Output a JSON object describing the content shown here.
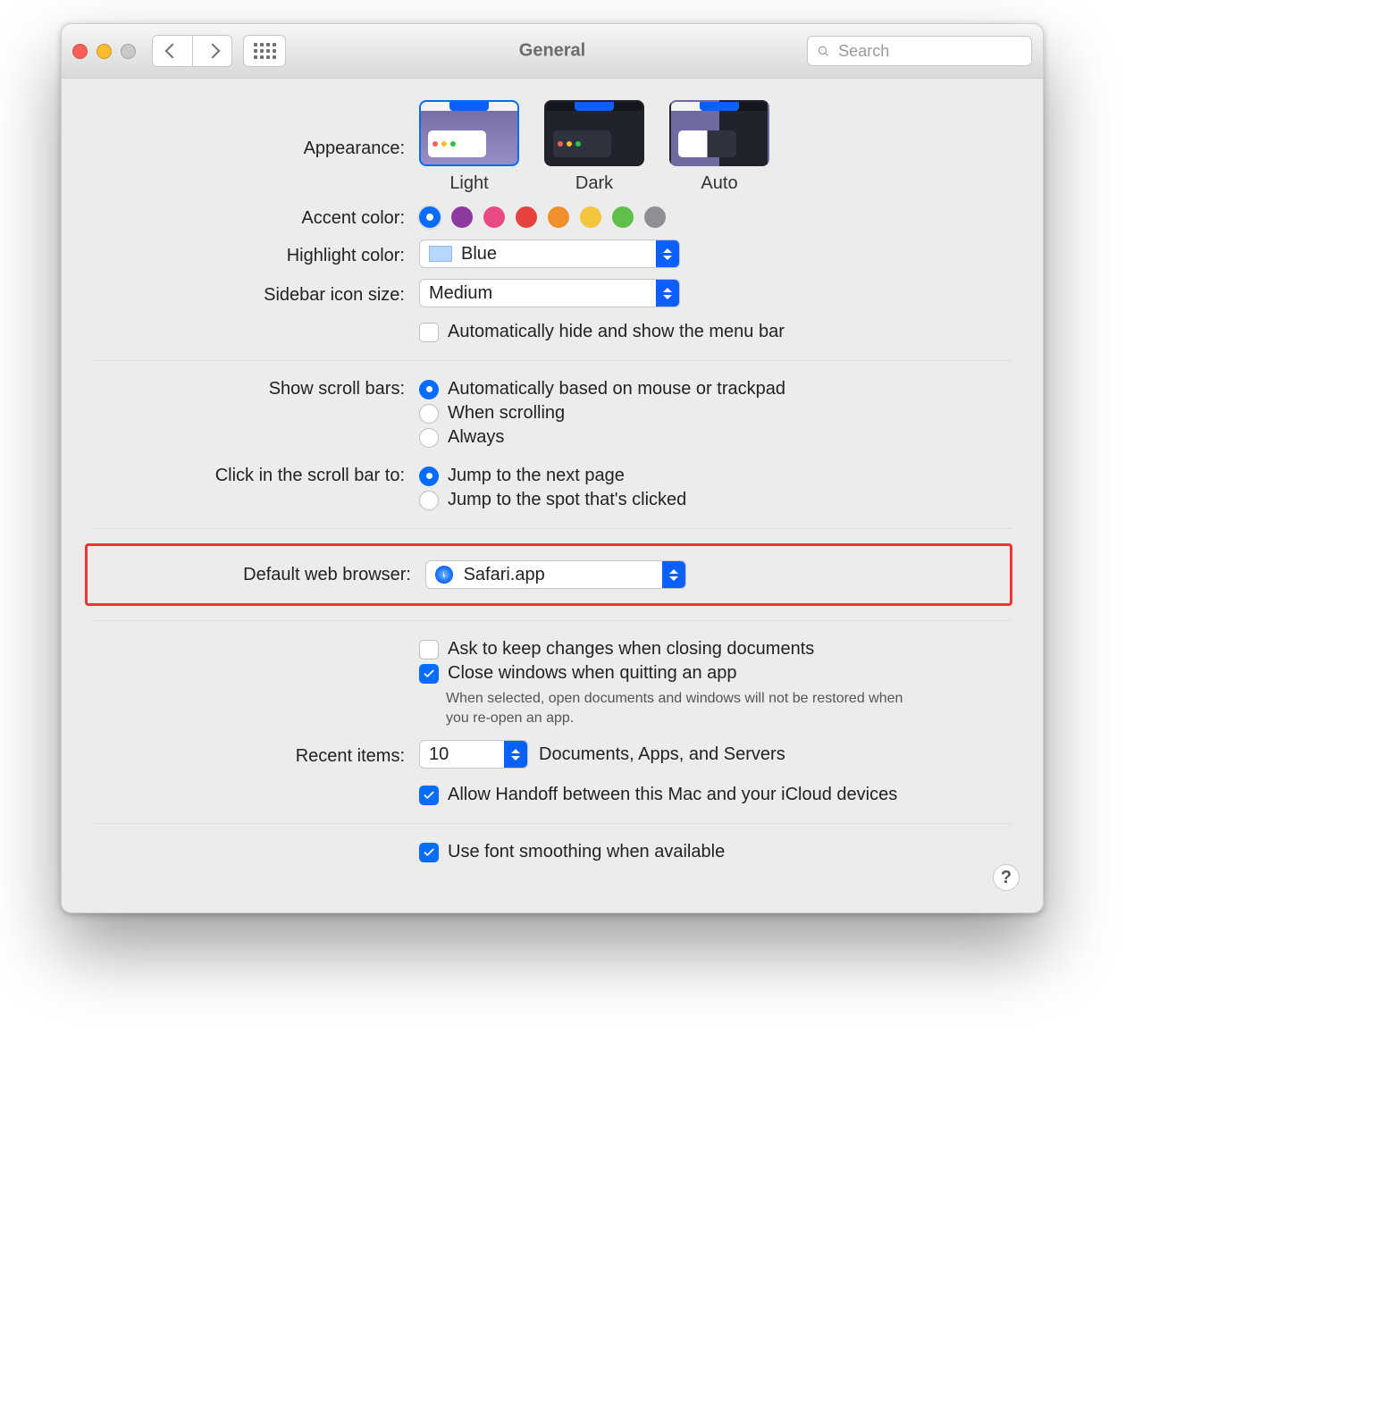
{
  "window": {
    "title": "General"
  },
  "search": {
    "placeholder": "Search"
  },
  "appearance": {
    "label": "Appearance:",
    "options": [
      "Light",
      "Dark",
      "Auto"
    ],
    "selected": "Light"
  },
  "accent": {
    "label": "Accent color:",
    "colors": [
      "#056cff",
      "#8e3aa1",
      "#e94a84",
      "#e6423f",
      "#f08f2c",
      "#f3c63e",
      "#5fbf4a",
      "#8e8e93"
    ],
    "selected_index": 0
  },
  "highlight": {
    "label": "Highlight color:",
    "value": "Blue",
    "swatch": "#b6d7ff"
  },
  "sidebar_icon": {
    "label": "Sidebar icon size:",
    "value": "Medium"
  },
  "menu_bar_autohide": {
    "label": "Automatically hide and show the menu bar",
    "checked": false
  },
  "scrollbars": {
    "label": "Show scroll bars:",
    "options": [
      "Automatically based on mouse or trackpad",
      "When scrolling",
      "Always"
    ],
    "selected_index": 0
  },
  "scrollbar_click": {
    "label": "Click in the scroll bar to:",
    "options": [
      "Jump to the next page",
      "Jump to the spot that's clicked"
    ],
    "selected_index": 0
  },
  "default_browser": {
    "label": "Default web browser:",
    "value": "Safari.app"
  },
  "documents": {
    "ask_keep_changes": {
      "label": "Ask to keep changes when closing documents",
      "checked": false
    },
    "close_windows_on_quit": {
      "label": "Close windows when quitting an app",
      "checked": true,
      "note": "When selected, open documents and windows will not be restored when you re-open an app."
    }
  },
  "recent_items": {
    "label": "Recent items:",
    "value": "10",
    "suffix": "Documents, Apps, and Servers"
  },
  "handoff": {
    "label": "Allow Handoff between this Mac and your iCloud devices",
    "checked": true
  },
  "font_smoothing": {
    "label": "Use font smoothing when available",
    "checked": true
  }
}
